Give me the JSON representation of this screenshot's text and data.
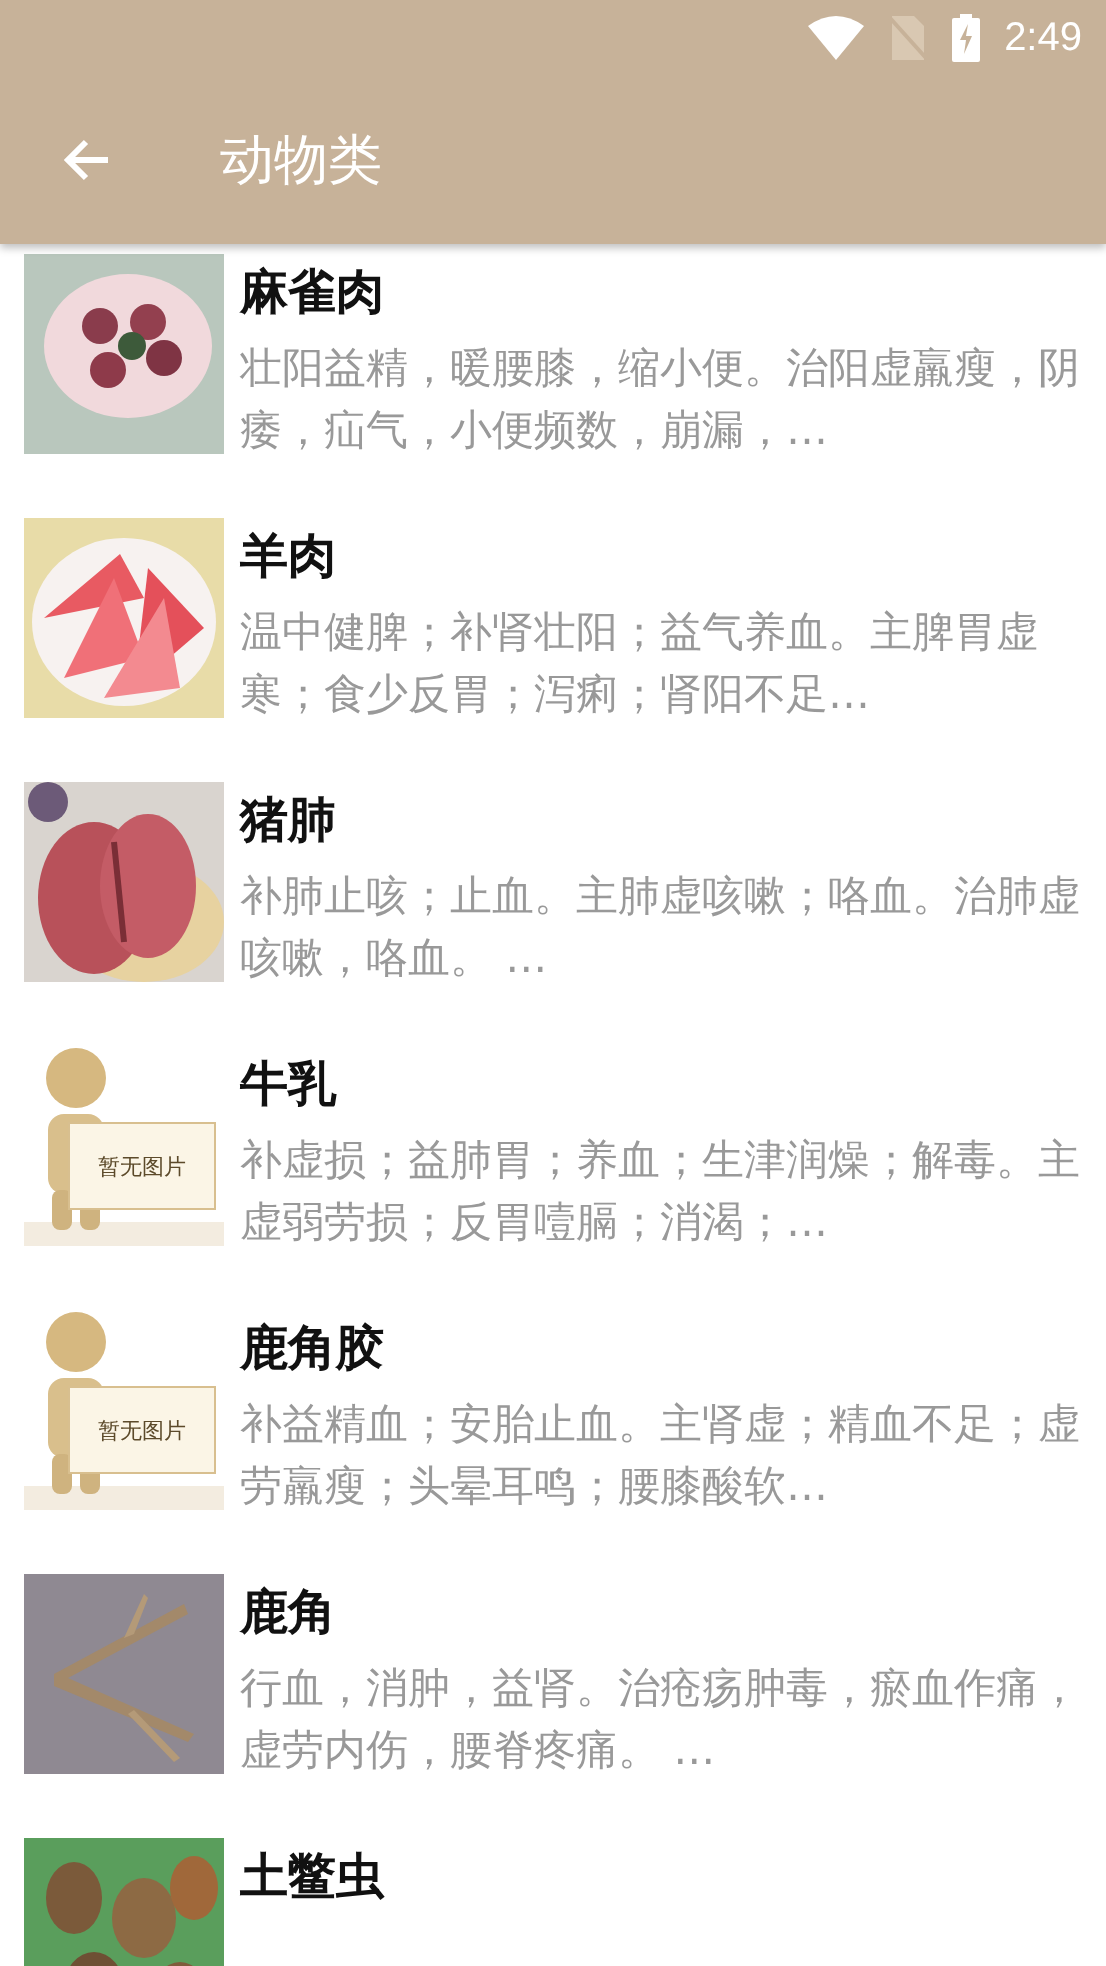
{
  "status_bar": {
    "time": "2:49"
  },
  "toolbar": {
    "title": "动物类"
  },
  "items": [
    {
      "name": "麻雀肉",
      "description": "壮阳益精，暖腰膝，缩小便。治阳虚羸瘦，阴痿，疝气，小便频数，崩漏，…"
    },
    {
      "name": "羊肉",
      "description": "温中健脾；补肾壮阳；益气养血。主脾胃虚寒；食少反胃；泻痢；肾阳不足…"
    },
    {
      "name": "猪肺",
      "description": "补肺止咳；止血。主肺虚咳嗽；咯血。治肺虚咳嗽，咯血。 …"
    },
    {
      "name": "牛乳",
      "description": "补虚损；益肺胃；养血；生津润燥；解毒。主虚弱劳损；反胃噎膈；消渴；…",
      "image": {
        "kind": "placeholder",
        "label": "暂无图片"
      }
    },
    {
      "name": "鹿角胶",
      "description": "补益精血；安胎止血。主肾虚；精血不足；虚劳羸瘦；头晕耳鸣；腰膝酸软…",
      "image": {
        "kind": "placeholder",
        "label": "暂无图片"
      }
    },
    {
      "name": "鹿角",
      "description": "行血，消肿，益肾。治疮疡肿毒，瘀血作痛，虚劳内伤，腰脊疼痛。 …"
    },
    {
      "name": "土鳖虫"
    }
  ]
}
